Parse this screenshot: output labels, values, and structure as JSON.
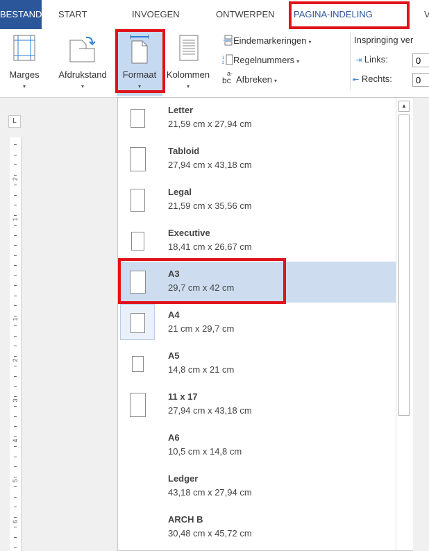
{
  "tabs": {
    "file": "BESTAND",
    "start": "START",
    "insert": "INVOEGEN",
    "design": "ONTWERPEN",
    "layout": "PAGINA-INDELING",
    "next": "V"
  },
  "ribbon": {
    "margins": "Marges",
    "orientation": "Afdrukstand",
    "size": "Formaat",
    "columns": "Kolommen",
    "breaks": "Eindemarkeringen",
    "line_numbers": "Regelnummers",
    "hyphenation": "Afbreken",
    "hyphen_glyph": "a-",
    "hyphen_bc": "bc",
    "indent_heading": "Inspringing ver",
    "left": "Links:",
    "right": "Rechts:",
    "left_value": "0",
    "right_value": "0",
    "dropdown_arrow": "▾"
  },
  "ruler": {
    "tab_marker": "L",
    "numbers": [
      "2",
      "1",
      "1",
      "2",
      "3",
      "4",
      "5",
      "6"
    ]
  },
  "paper_sizes": [
    {
      "name": "Letter",
      "size": "21,59 cm x 27,94 cm"
    },
    {
      "name": "Tabloid",
      "size": "27,94 cm x 43,18 cm"
    },
    {
      "name": "Legal",
      "size": "21,59 cm x 35,56 cm"
    },
    {
      "name": "Executive",
      "size": "18,41 cm x 26,67 cm"
    },
    {
      "name": "A3",
      "size": "29,7 cm x 42 cm"
    },
    {
      "name": "A4",
      "size": "21 cm x 29,7 cm"
    },
    {
      "name": "A5",
      "size": "14,8 cm x 21 cm"
    },
    {
      "name": "11 x 17",
      "size": "27,94 cm x 43,18 cm"
    },
    {
      "name": "A6",
      "size": "10,5 cm x 14,8 cm"
    },
    {
      "name": "Ledger",
      "size": "43,18 cm x 27,94 cm"
    },
    {
      "name": "ARCH B",
      "size": "30,48 cm x 45,72 cm"
    }
  ],
  "colors": {
    "file_tab": "#2b579a",
    "highlight_box": "#e0131b",
    "hover_item": "#cddcef",
    "selected_item": "#eaf1fb",
    "active_tab_text": "#2b579a"
  }
}
